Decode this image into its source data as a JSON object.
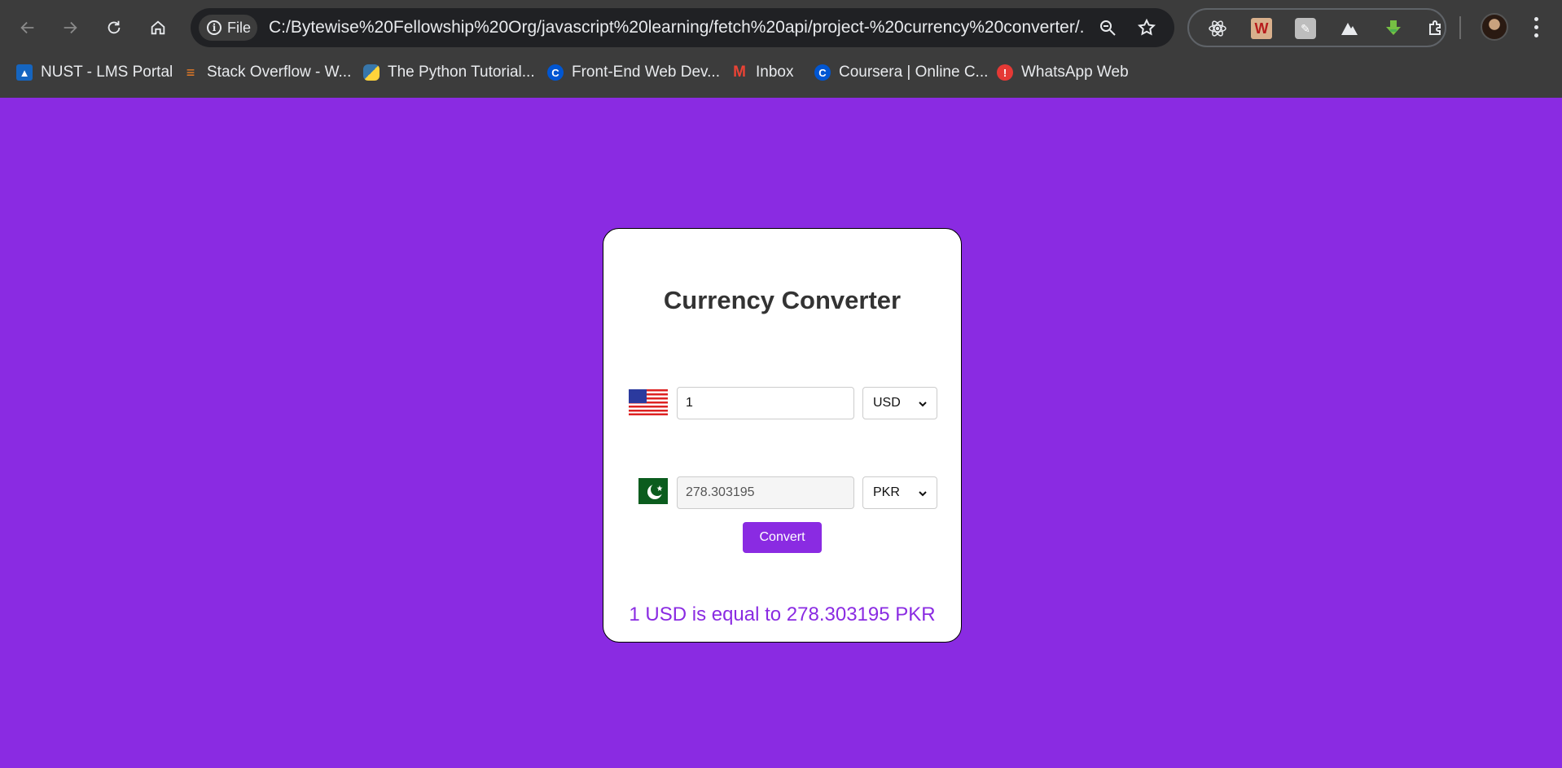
{
  "browser": {
    "file_chip": "File",
    "url": "C:/Bytewise%20Fellowship%20Org/javascript%20learning/fetch%20api/project-%20currency%20converter/...",
    "bookmarks": [
      {
        "label": "NUST - LMS Portal",
        "icon": "graduation-cap-icon",
        "color": "#1565c0"
      },
      {
        "label": "Stack Overflow - W...",
        "icon": "stackoverflow-icon",
        "color": "#f48024"
      },
      {
        "label": "The Python Tutorial...",
        "icon": "python-icon",
        "color": "#3776ab"
      },
      {
        "label": "Front-End Web Dev...",
        "icon": "coursera-icon",
        "color": "#0056d2"
      },
      {
        "label": "Inbox",
        "icon": "gmail-icon",
        "color": "#ea4335"
      },
      {
        "label": "Coursera | Online C...",
        "icon": "coursera-icon",
        "color": "#0056d2"
      },
      {
        "label": "WhatsApp Web",
        "icon": "whatsapp-alert-icon",
        "color": "#e53935"
      }
    ]
  },
  "app": {
    "title": "Currency Converter",
    "from": {
      "amount": "1",
      "currency": "USD",
      "flag": "us-flag-icon"
    },
    "to": {
      "amount": "278.303195",
      "currency": "PKR",
      "flag": "pk-flag-icon"
    },
    "convert_label": "Convert",
    "result": "1 USD is equal to 278.303195 PKR",
    "accent": "#8a2be2"
  }
}
